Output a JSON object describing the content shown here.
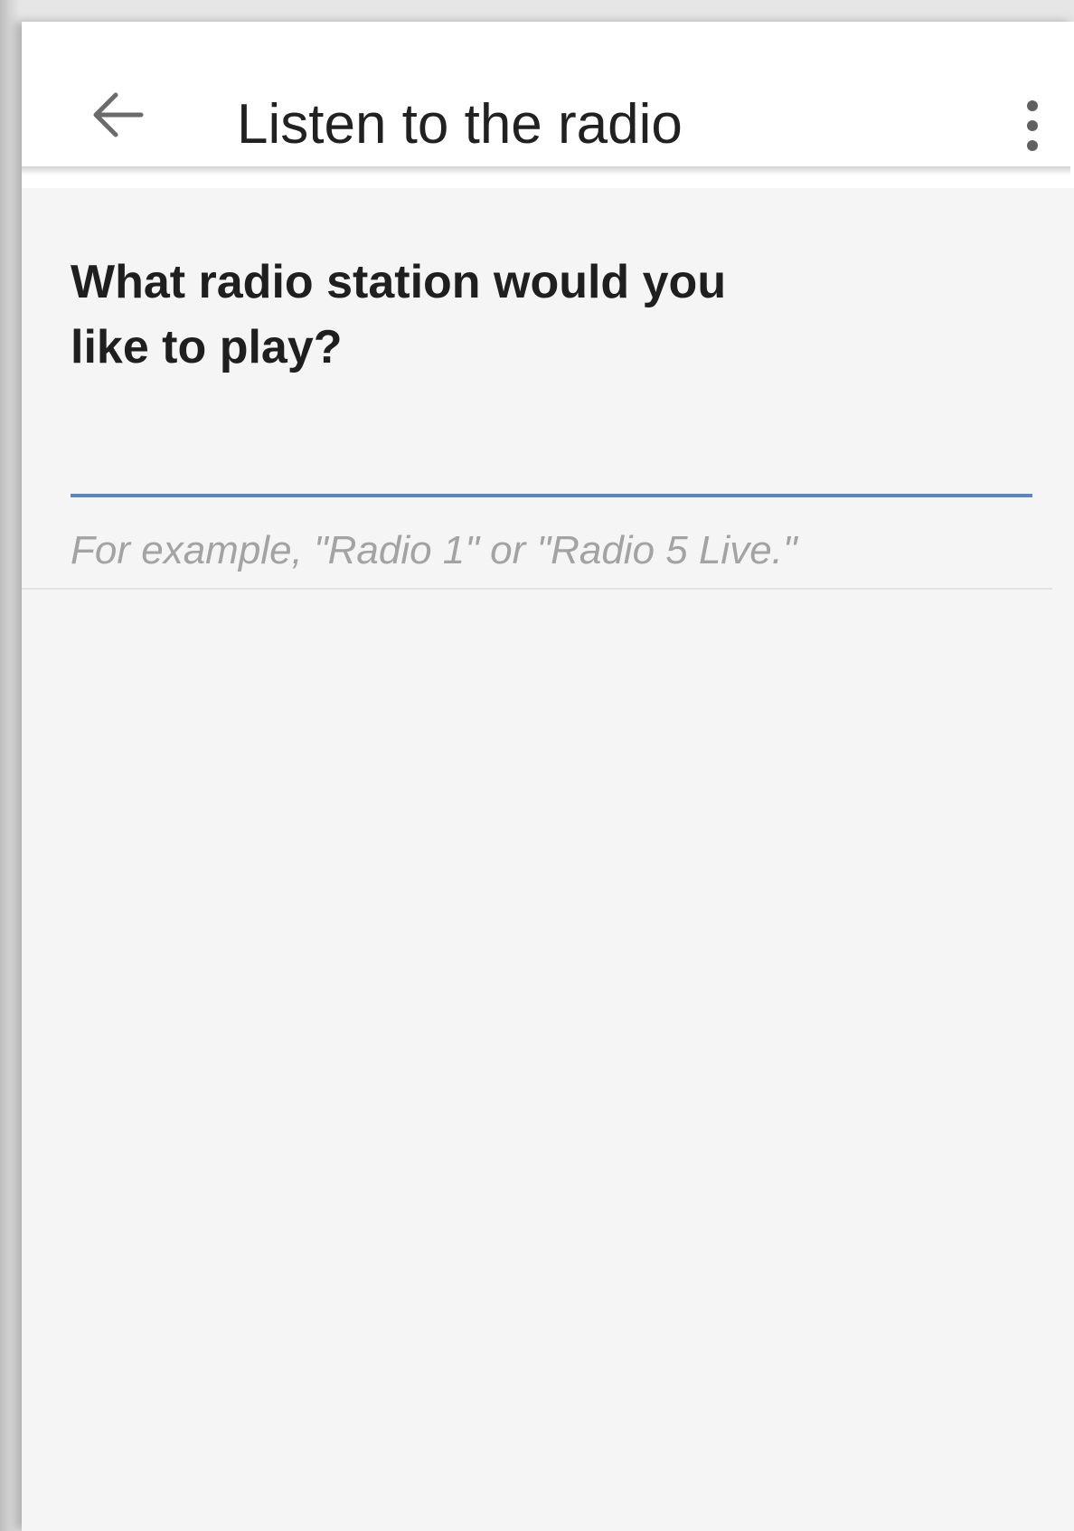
{
  "header": {
    "title": "Listen to the radio",
    "back_icon": "arrow-left-icon",
    "menu_icon": "more-vert-icon"
  },
  "form": {
    "question": "What radio station would you like to play?",
    "input_value": "",
    "hint": "For example, \"Radio 1\" or \"Radio 5 Live.\""
  },
  "colors": {
    "accent": "#5b86c5",
    "background": "#f6f5f6",
    "appbar": "#ffffff",
    "text": "#212121",
    "hint": "#a3a3a3"
  }
}
